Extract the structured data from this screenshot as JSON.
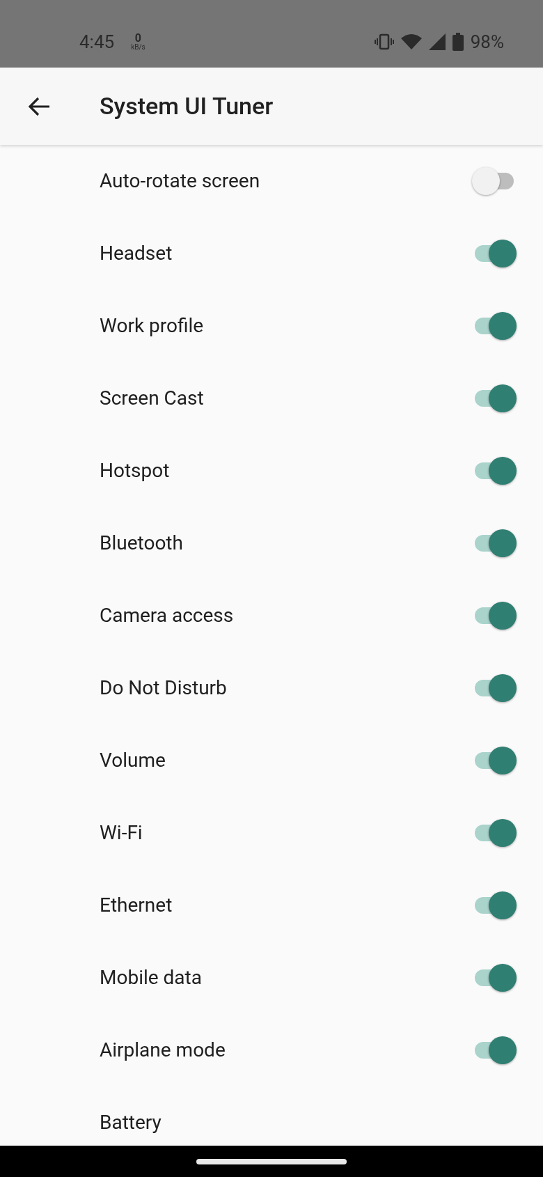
{
  "status_bar": {
    "time": "4:45",
    "speed_value": "0",
    "speed_unit": "kB/s",
    "battery": "98%"
  },
  "app_bar": {
    "title": "System UI Tuner"
  },
  "settings": [
    {
      "label": "Auto-rotate screen",
      "on": false
    },
    {
      "label": "Headset",
      "on": true
    },
    {
      "label": "Work profile",
      "on": true
    },
    {
      "label": "Screen Cast",
      "on": true
    },
    {
      "label": "Hotspot",
      "on": true
    },
    {
      "label": "Bluetooth",
      "on": true
    },
    {
      "label": "Camera access",
      "on": true
    },
    {
      "label": "Do Not Disturb",
      "on": true
    },
    {
      "label": "Volume",
      "on": true
    },
    {
      "label": "Wi-Fi",
      "on": true
    },
    {
      "label": "Ethernet",
      "on": true
    },
    {
      "label": "Mobile data",
      "on": true
    },
    {
      "label": "Airplane mode",
      "on": true
    },
    {
      "label": "Battery",
      "kind": "plain"
    }
  ]
}
